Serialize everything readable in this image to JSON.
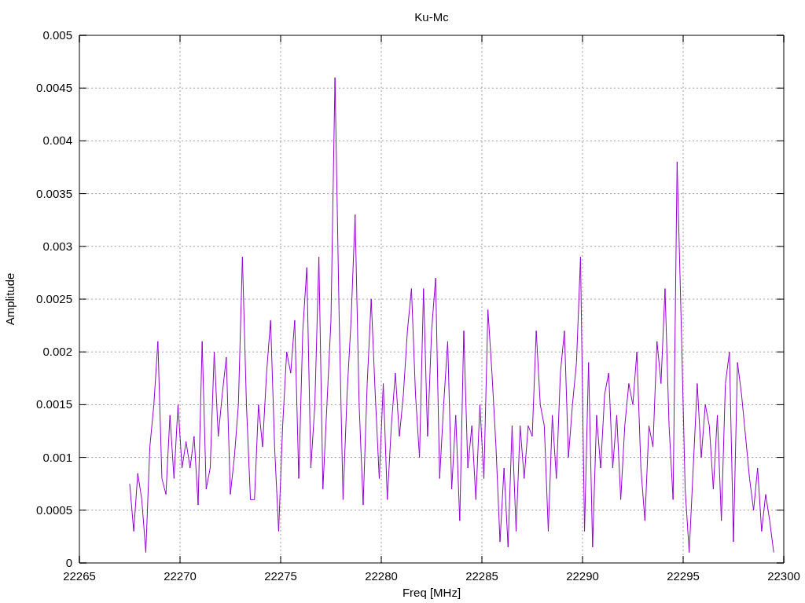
{
  "chart_data": {
    "type": "line",
    "title": "Ku-Mc",
    "xlabel": "Freq [MHz]",
    "ylabel": "Amplitude",
    "grid": true,
    "xlim": [
      22265,
      22300
    ],
    "ylim": [
      0,
      0.005
    ],
    "xticks": [
      22265,
      22270,
      22275,
      22280,
      22285,
      22290,
      22295,
      22300
    ],
    "yticks": [
      0,
      0.0005,
      0.001,
      0.0015,
      0.002,
      0.0025,
      0.003,
      0.0035,
      0.004,
      0.0045,
      0.005
    ],
    "x": [
      22267.5,
      22267.7,
      22267.9,
      22268.1,
      22268.3,
      22268.5,
      22268.7,
      22268.9,
      22269.1,
      22269.3,
      22269.5,
      22269.7,
      22269.9,
      22270.1,
      22270.3,
      22270.5,
      22270.7,
      22270.9,
      22271.1,
      22271.3,
      22271.5,
      22271.7,
      22271.9,
      22272.1,
      22272.3,
      22272.5,
      22272.7,
      22272.9,
      22273.1,
      22273.3,
      22273.5,
      22273.7,
      22273.9,
      22274.1,
      22274.3,
      22274.5,
      22274.7,
      22274.9,
      22275.1,
      22275.3,
      22275.5,
      22275.7,
      22275.9,
      22276.1,
      22276.3,
      22276.5,
      22276.7,
      22276.9,
      22277.1,
      22277.3,
      22277.5,
      22277.7,
      22277.9,
      22278.1,
      22278.3,
      22278.5,
      22278.7,
      22278.9,
      22279.1,
      22279.3,
      22279.5,
      22279.7,
      22279.9,
      22280.1,
      22280.3,
      22280.5,
      22280.7,
      22280.9,
      22281.1,
      22281.3,
      22281.5,
      22281.7,
      22281.9,
      22282.1,
      22282.3,
      22282.5,
      22282.7,
      22282.9,
      22283.1,
      22283.3,
      22283.5,
      22283.7,
      22283.9,
      22284.1,
      22284.3,
      22284.5,
      22284.7,
      22284.9,
      22285.1,
      22285.3,
      22285.5,
      22285.7,
      22285.9,
      22286.1,
      22286.3,
      22286.5,
      22286.7,
      22286.9,
      22287.1,
      22287.3,
      22287.5,
      22287.7,
      22287.9,
      22288.1,
      22288.3,
      22288.5,
      22288.7,
      22288.9,
      22289.1,
      22289.3,
      22289.5,
      22289.7,
      22289.9,
      22290.1,
      22290.3,
      22290.5,
      22290.7,
      22290.9,
      22291.1,
      22291.3,
      22291.5,
      22291.7,
      22291.9,
      22292.1,
      22292.3,
      22292.5,
      22292.7,
      22292.9,
      22293.1,
      22293.3,
      22293.5,
      22293.7,
      22293.9,
      22294.1,
      22294.3,
      22294.5,
      22294.7,
      22294.9,
      22295.1,
      22295.3,
      22295.5,
      22295.7,
      22295.9,
      22296.1,
      22296.3,
      22296.5,
      22296.7,
      22296.9,
      22297.1,
      22297.3,
      22297.5,
      22297.7,
      22297.9,
      22298.1,
      22298.3,
      22298.5,
      22298.7,
      22298.9,
      22299.1,
      22299.3,
      22299.5
    ],
    "series": [
      {
        "color": "#9400d3",
        "values": [
          0.00075,
          0.0003,
          0.00085,
          0.0006,
          0.0001,
          0.0011,
          0.0015,
          0.0021,
          0.0008,
          0.00065,
          0.0014,
          0.0008,
          0.0015,
          0.0009,
          0.00115,
          0.0009,
          0.0012,
          0.00055,
          0.0021,
          0.0007,
          0.0009,
          0.002,
          0.0012,
          0.0016,
          0.00195,
          0.00065,
          0.001,
          0.0015,
          0.0029,
          0.0015,
          0.0006,
          0.0006,
          0.0015,
          0.0011,
          0.0018,
          0.0023,
          0.0011,
          0.0003,
          0.0013,
          0.002,
          0.0018,
          0.0023,
          0.0008,
          0.0022,
          0.0028,
          0.0009,
          0.0015,
          0.0029,
          0.0007,
          0.0015,
          0.0023,
          0.0046,
          0.0024,
          0.0006,
          0.0016,
          0.0023,
          0.0033,
          0.0015,
          0.00055,
          0.0017,
          0.0025,
          0.0016,
          0.0008,
          0.0017,
          0.0006,
          0.0013,
          0.0018,
          0.0012,
          0.0016,
          0.0022,
          0.0026,
          0.0016,
          0.001,
          0.0026,
          0.0012,
          0.0022,
          0.0027,
          0.0008,
          0.0015,
          0.0021,
          0.0007,
          0.0014,
          0.0004,
          0.0022,
          0.0009,
          0.0013,
          0.0006,
          0.0015,
          0.0008,
          0.0024,
          0.0018,
          0.0011,
          0.0002,
          0.0009,
          0.00015,
          0.0013,
          0.0003,
          0.0013,
          0.0008,
          0.0013,
          0.0012,
          0.0022,
          0.0015,
          0.0013,
          0.0003,
          0.0014,
          0.0008,
          0.0018,
          0.0022,
          0.001,
          0.0015,
          0.0019,
          0.0029,
          0.0003,
          0.0019,
          0.00015,
          0.0014,
          0.0009,
          0.0016,
          0.0018,
          0.0009,
          0.0014,
          0.0006,
          0.0013,
          0.0017,
          0.0015,
          0.002,
          0.0009,
          0.0004,
          0.0013,
          0.0011,
          0.0021,
          0.0017,
          0.0026,
          0.0013,
          0.0006,
          0.0038,
          0.0023,
          0.0007,
          0.0001,
          0.0009,
          0.0017,
          0.001,
          0.0015,
          0.0013,
          0.0007,
          0.0014,
          0.0004,
          0.0017,
          0.002,
          0.0002,
          0.0019,
          0.0016,
          0.0012,
          0.0008,
          0.0005,
          0.0009,
          0.0003,
          0.00065,
          0.0004,
          0.0001
        ]
      }
    ]
  }
}
